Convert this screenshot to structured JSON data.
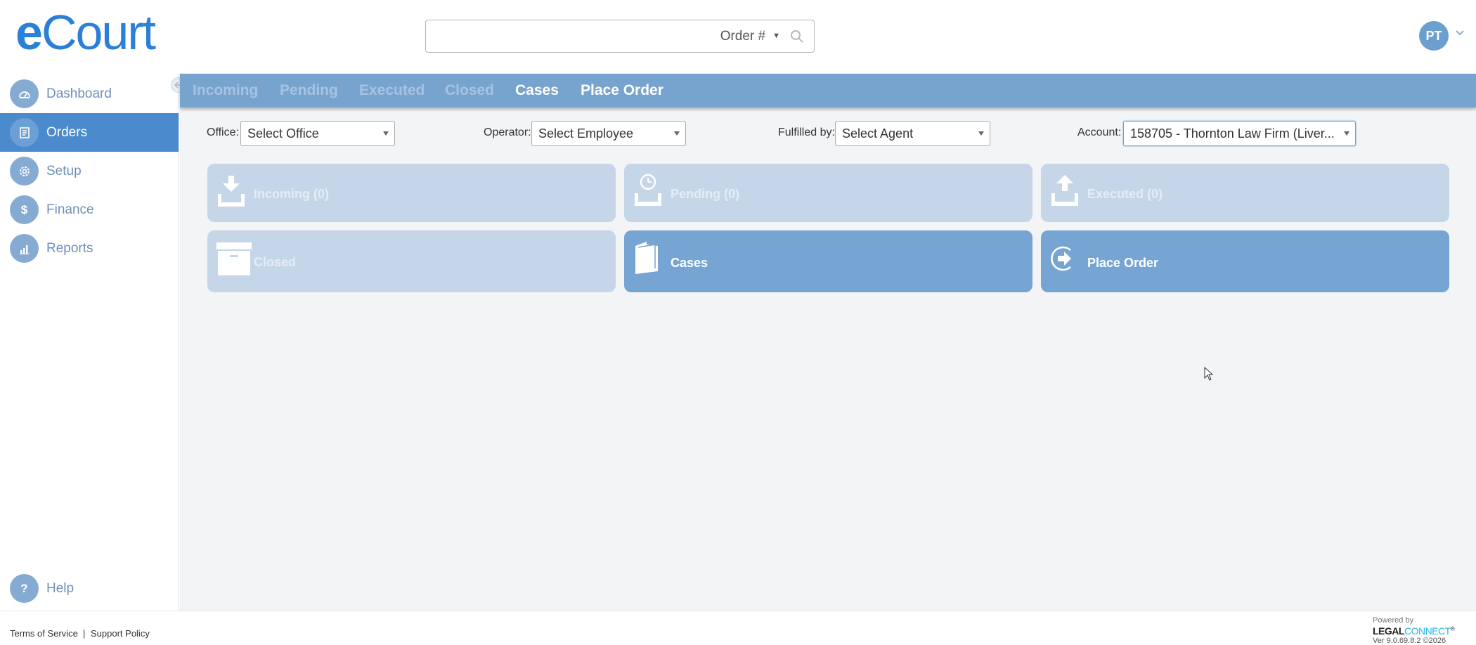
{
  "header": {
    "logo_e": "e",
    "logo_rest": "Court",
    "search": {
      "value": "",
      "mode": "Order #"
    },
    "user_initials": "PT"
  },
  "sidebar": {
    "items": [
      {
        "label": "Dashboard",
        "icon": "dashboard-icon"
      },
      {
        "label": "Orders",
        "icon": "orders-icon",
        "active": true
      },
      {
        "label": "Setup",
        "icon": "gear-icon"
      },
      {
        "label": "Finance",
        "icon": "dollar-icon"
      },
      {
        "label": "Reports",
        "icon": "bar-chart-icon"
      }
    ],
    "help_label": "Help"
  },
  "tabs": [
    {
      "label": "Incoming",
      "enabled": false
    },
    {
      "label": "Pending",
      "enabled": false
    },
    {
      "label": "Executed",
      "enabled": false
    },
    {
      "label": "Closed",
      "enabled": false
    },
    {
      "label": "Cases",
      "enabled": true
    },
    {
      "label": "Place Order",
      "enabled": true
    }
  ],
  "filters": {
    "office": {
      "label": "Office:",
      "value": "Select Office"
    },
    "operator": {
      "label": "Operator:",
      "value": "Select Employee"
    },
    "fulfilled_by": {
      "label": "Fulfilled by:",
      "value": "Select Agent"
    },
    "account": {
      "label": "Account:",
      "value": "158705 - Thornton Law Firm (Liver..."
    }
  },
  "tiles": [
    {
      "label": "Incoming (0)",
      "icon": "inbox-download-icon",
      "enabled": false
    },
    {
      "label": "Pending (0)",
      "icon": "clock-tray-icon",
      "enabled": false
    },
    {
      "label": "Executed (0)",
      "icon": "outbox-upload-icon",
      "enabled": false
    },
    {
      "label": "Closed",
      "icon": "archive-box-icon",
      "enabled": false
    },
    {
      "label": "Cases",
      "icon": "folder-icon",
      "enabled": true
    },
    {
      "label": "Place Order",
      "icon": "arrow-circle-icon",
      "enabled": true
    }
  ],
  "footer": {
    "terms": "Terms of Service",
    "separator": "|",
    "support": "Support Policy",
    "powered_by": "Powered by",
    "brand_a": "LEGAL",
    "brand_b": "CONNECT",
    "brand_mark": "®",
    "version": "Ver 9.0.69.8.2 ©2026"
  },
  "colors": {
    "accent": "#4b8bcd",
    "tabbar": "#77a4cf",
    "tile_active": "#76a5d3",
    "tile_disabled": "#c5d6e8"
  }
}
